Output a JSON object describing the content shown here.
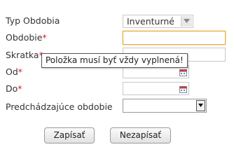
{
  "form": {
    "type": {
      "label": "Typ Obdobia",
      "value": "Inventurné"
    },
    "period": {
      "label": "Obdobie",
      "required_mark": "*",
      "value": ""
    },
    "short": {
      "label": "Skratka",
      "required_mark": "*",
      "value": ""
    },
    "from": {
      "label": "Od",
      "required_mark": "*",
      "value": ""
    },
    "to": {
      "label": "Do",
      "required_mark": "*",
      "value": ""
    },
    "previous": {
      "label": "Predchádzajúce obdobie",
      "value": ""
    }
  },
  "tooltip": {
    "text": "Položka musí byť vždy vyplnená!"
  },
  "buttons": {
    "save": "Zapísať",
    "cancel": "Nezapísať"
  },
  "icons": {
    "calendar": "calendar-icon",
    "dropdown": "chevron-down-icon"
  },
  "colors": {
    "required": "#d0202a",
    "focus_border": "#e8a838",
    "calendar_icon": "#c04040"
  }
}
